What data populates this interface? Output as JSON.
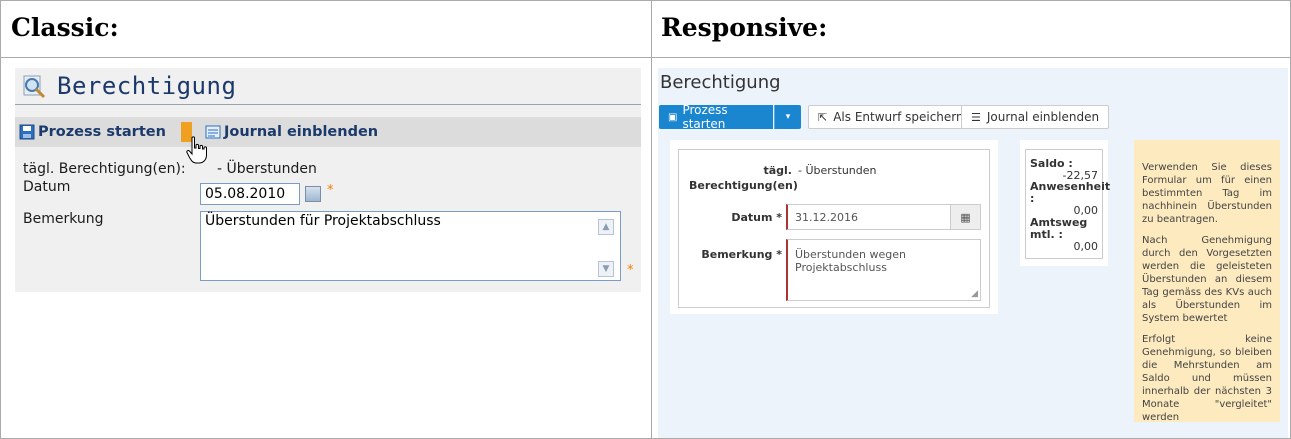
{
  "headers": {
    "classic": "Classic:",
    "responsive": "Responsive:"
  },
  "classic": {
    "title": "Berechtigung",
    "toolbar": {
      "start": "Prozess starten",
      "journal": "Journal einblenden"
    },
    "fields": {
      "berechtigung_label": "tägl. Berechtigung(en):",
      "berechtigung_value": "- Überstunden",
      "datum_label": "Datum",
      "datum_value": "05.08.2010",
      "bemerkung_label": "Bemerkung",
      "bemerkung_value": "Überstunden für Projektabschluss",
      "required_mark": "*"
    }
  },
  "responsive": {
    "title": "Berechtigung",
    "buttons": {
      "start": "Prozess starten",
      "draft": "Als Entwurf speichern",
      "journal": "Journal einblenden"
    },
    "form": {
      "berechtigung_label_1": "tägl.",
      "berechtigung_label_2": "Berechtigung(en)",
      "berechtigung_value": "- Überstunden",
      "datum_label": "Datum *",
      "datum_value": "31.12.2016",
      "bemerkung_label": "Bemerkung *",
      "bemerkung_value": "Überstunden wegen Projektabschluss"
    },
    "saldo": {
      "saldo_label": "Saldo :",
      "saldo_value": "-22,57",
      "anwesenheit_label_1": "Anwesenheit",
      "anwesenheit_label_2": ":",
      "anwesenheit_value": "0,00",
      "amtsweg_label_1": "Amtsweg",
      "amtsweg_label_2": "mtl. :",
      "amtsweg_value": "0,00"
    },
    "info": [
      "Verwenden Sie dieses Formular um für einen bestimmten Tag im nachhinein Überstunden zu beantragen.",
      "Nach Genehmigung durch den Vorgesetzten werden die geleisteten Überstunden an diesem Tag gemäss des KVs auch als Überstunden im System bewertet",
      "Erfolgt keine Genehmigung, so bleiben die Mehrstunden am Saldo und müssen innerhalb der nächsten 3 Monate \"vergleitet\" werden"
    ]
  }
}
